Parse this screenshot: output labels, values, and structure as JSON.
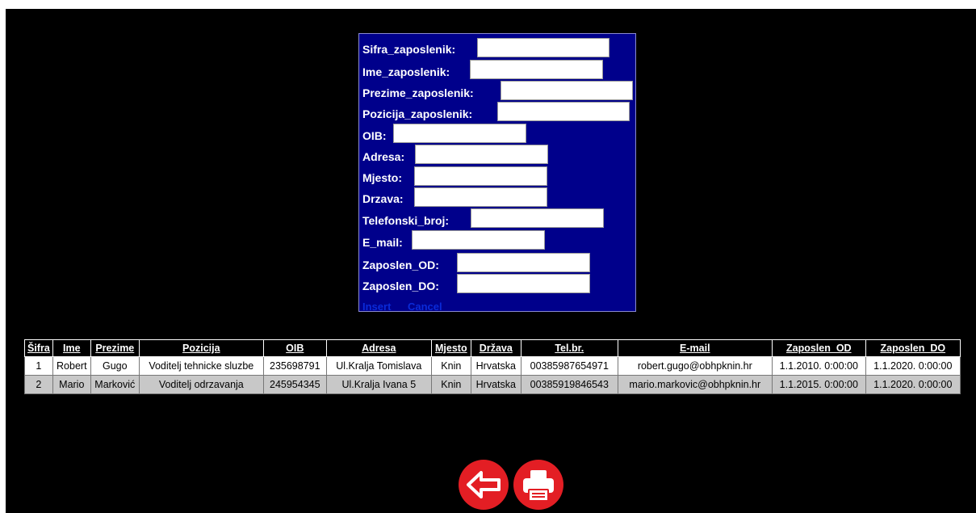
{
  "form": {
    "fields": [
      {
        "label": "Sifra_zaposlenik:",
        "value": ""
      },
      {
        "label": "Ime_zaposlenik:",
        "value": ""
      },
      {
        "label": "Prezime_zaposlenik:",
        "value": ""
      },
      {
        "label": "Pozicija_zaposlenik:",
        "value": ""
      },
      {
        "label": "OIB:",
        "value": ""
      },
      {
        "label": "Adresa:",
        "value": ""
      },
      {
        "label": "Mjesto:",
        "value": ""
      },
      {
        "label": "Drzava:",
        "value": ""
      },
      {
        "label": "Telefonski_broj:",
        "value": ""
      },
      {
        "label": "E_mail:",
        "value": ""
      },
      {
        "label": "Zaposlen_OD:",
        "value": ""
      },
      {
        "label": "Zaposlen_DO:",
        "value": ""
      }
    ],
    "insert_label": "Insert",
    "cancel_label": "Cancel"
  },
  "table": {
    "headers": [
      "Šifra",
      "Ime",
      "Prezime",
      "Pozicija",
      "OIB",
      "Adresa",
      "Mjesto",
      "Država",
      "Tel.br.",
      "E-mail",
      "Zaposlen_OD",
      "Zaposlen_DO"
    ],
    "rows": [
      [
        "1",
        "Robert",
        "Gugo",
        "Voditelj tehnicke sluzbe",
        "235698791",
        "Ul.Kralja Tomislava",
        "Knin",
        "Hrvatska",
        "00385987654971",
        "robert.gugo@obhpknin.hr",
        "1.1.2010. 0:00:00",
        "1.1.2020. 0:00:00"
      ],
      [
        "2",
        "Mario",
        "Marković",
        "Voditelj odrzavanja",
        "245954345",
        "Ul.Kralja Ivana 5",
        "Knin",
        "Hrvatska",
        "00385919846543",
        "mario.markovic@obhpknin.hr",
        "1.1.2015. 0:00:00",
        "1.1.2020. 0:00:00"
      ]
    ]
  },
  "buttons": {
    "back_icon": "arrow-left-icon",
    "print_icon": "printer-icon"
  },
  "colors": {
    "form_background": "#00008b",
    "page_background": "#000000",
    "button_red": "#e31e24",
    "row_alt": "#c8c8c8"
  }
}
